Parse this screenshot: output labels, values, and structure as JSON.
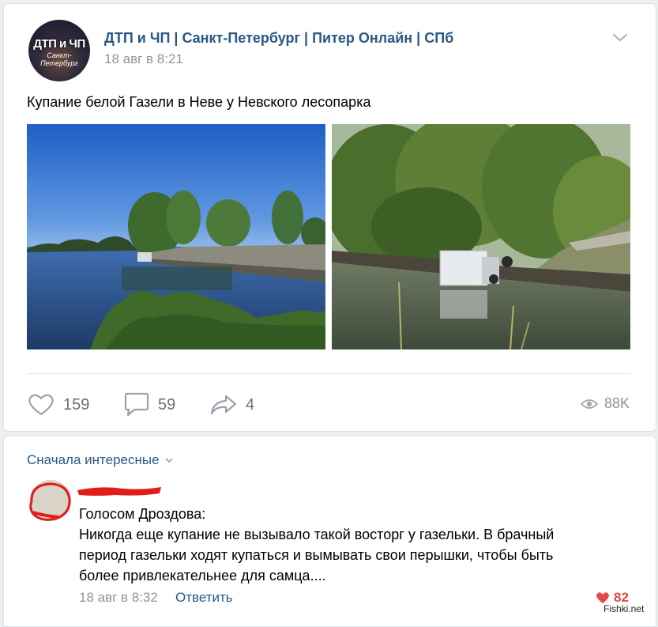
{
  "post": {
    "author": "ДТП и ЧП | Санкт-Петербург | Питер Онлайн | СПб",
    "date": "18 авг в 8:21",
    "text": "Купание белой Газели в Неве у Невского лесопарка",
    "avatar": {
      "line1": "ДТП и ЧП",
      "line2": "Санкт-Петербург"
    },
    "photos": [
      "river-view-photo",
      "overturned-van-photo"
    ],
    "actions": {
      "likes": "159",
      "comments": "59",
      "shares": "4",
      "views": "88K"
    }
  },
  "comments": {
    "sort_label": "Сначала интересные",
    "items": [
      {
        "lines": [
          "Голосом Дроздова:",
          "Никогда еще купание не вызывало такой восторг у газельки. В брачный",
          "период газельки ходят купаться и вымывать свои перышки, чтобы быть",
          "более привлекательнее для самца...."
        ],
        "date": "18 авг в 8:32",
        "reply_label": "Ответить",
        "likes": "82"
      }
    ]
  },
  "watermark": "Fishki.net",
  "colors": {
    "link": "#2a5885",
    "muted": "#939393",
    "like": "#e64646",
    "background": "#edeef0"
  },
  "icons": [
    "chevron-down-icon",
    "heart-icon",
    "comment-icon",
    "share-icon",
    "eye-icon",
    "heart-filled-icon"
  ]
}
